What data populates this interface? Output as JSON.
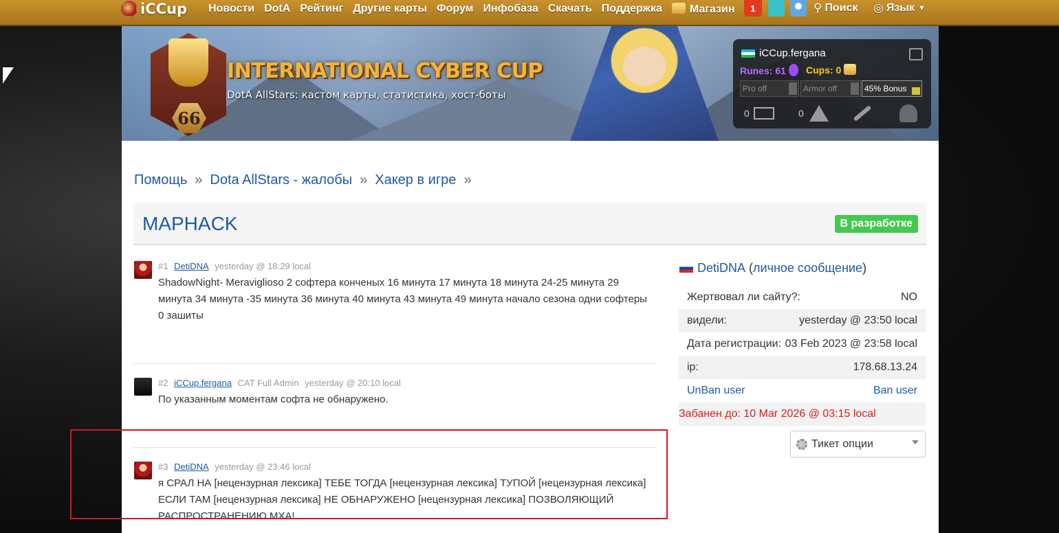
{
  "header": {
    "logo": "iCCup",
    "nav": [
      "Новости",
      "DotA",
      "Рейтинг",
      "Другие карты",
      "Форум",
      "Инфобаза",
      "Скачать",
      "Поддержка",
      "Магазин"
    ],
    "notifications": "1",
    "search": "Поиск",
    "language": "Язык"
  },
  "banner": {
    "title": "INTERNATIONAL CYBER CUP",
    "subtitle": "DotA AllStars: кастом карты, статистика, хост-боты",
    "badge": "66"
  },
  "user_panel": {
    "username": "iCCup.fergana",
    "runes_label": "Runes: 61",
    "cups_label": "Cups: 0",
    "pro_off": "Pro off",
    "armor_off": "Armor off",
    "bonus": "45% Bonus",
    "messages_count": "0",
    "warnings_count": "0"
  },
  "breadcrumb": {
    "items": [
      "Помощь",
      "Dota AllStars - жалобы",
      "Хакер в игре"
    ],
    "separator": "»"
  },
  "ticket": {
    "title": "MAPHACK",
    "status": "В разработке"
  },
  "posts": [
    {
      "num": "#1",
      "author": "DetiDNA",
      "role": "",
      "time": "yesterday @ 18:29 local",
      "text": "ShadowNight- Meraviglioso 2 софтера конченых 16 минута 17 минута 18 минута 24-25 минута 29 минута 34 минута -35 минута 36 минута 40 минута 43 минута 49 минута начало сезона одни софтеры 0 зашиты"
    },
    {
      "num": "#2",
      "author": "iCCup.fergana",
      "role": "CAT Full Admin",
      "time": "yesterday @ 20:10 local",
      "text": "По указанным моментам софта не обнаружено."
    },
    {
      "num": "#3",
      "author": "DetiDNA",
      "role": "",
      "time": "yesterday @ 23:46 local",
      "text": "я СРАЛ НА [нецензурная лексика] ТЕБЕ ТОГДА [нецензурная лексика] ТУПОЙ [нецензурная лексика] ЕСЛИ ТАМ [нецензурная лексика] НЕ ОБНАРУЖЕНО [нецензурная лексика] ПОЗВОЛЯЮЩИЙ РАСПРОСТРАНЕНИЮ МХА!"
    }
  ],
  "sidebar": {
    "user": "DetiDNA",
    "pm_link": "личное сообщение",
    "rows": [
      {
        "label": "Жертвовал ли сайту?:",
        "value": "NO"
      },
      {
        "label": "видели:",
        "value": "yesterday @ 23:50 local"
      },
      {
        "label": "Дата регистрации:",
        "value": "03 Feb 2023 @ 23:58 local"
      },
      {
        "label": "ip:",
        "value": "178.68.13.24"
      }
    ],
    "unban": "UnBan user",
    "ban": "Ban user",
    "banned_until": "Забанен до: 10 Mar 2026 @ 03:15 local",
    "ticket_options": "Тикет опции"
  }
}
